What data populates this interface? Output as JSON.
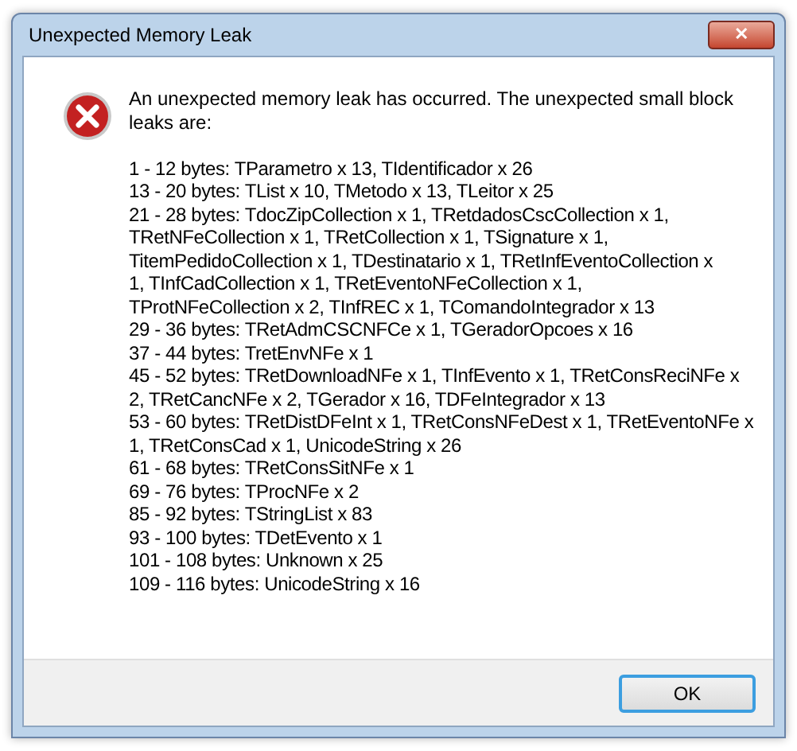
{
  "window": {
    "title": "Unexpected Memory Leak",
    "close": "✕"
  },
  "message": "An unexpected memory leak has occurred. The unexpected small block leaks are:",
  "leak_lines": [
    "1 - 12 bytes: TParametro x 13, TIdentificador x 26",
    "13 - 20 bytes: TList x 10, TMetodo x 13, TLeitor x 25",
    "21 - 28 bytes: TdocZipCollection x 1, TRetdadosCscCollection x 1,",
    "TRetNFeCollection x 1, TRetCollection x 1, TSignature x 1,",
    "TitemPedidoCollection x 1, TDestinatario x 1, TRetInfEventoCollection x",
    "1, TInfCadCollection x 1, TRetEventoNFeCollection x 1,",
    "TProtNFeCollection x 2, TInfREC x 1, TComandoIntegrador x 13",
    "29 - 36 bytes: TRetAdmCSCNFCe x 1, TGeradorOpcoes x 16",
    "37 - 44 bytes: TretEnvNFe x 1",
    "45 - 52 bytes: TRetDownloadNFe x 1, TInfEvento x 1, TRetConsReciNFe x",
    "2, TRetCancNFe x 2, TGerador x 16, TDFeIntegrador x 13",
    "53 - 60 bytes: TRetDistDFeInt x 1, TRetConsNFeDest x 1, TRetEventoNFe x",
    "1, TRetConsCad x 1, UnicodeString x 26",
    "61 - 68 bytes: TRetConsSitNFe x 1",
    "69 - 76 bytes: TProcNFe x 2",
    "85 - 92 bytes: TStringList x 83",
    "93 - 100 bytes: TDetEvento x 1",
    "101 - 108 bytes: Unknown x 25",
    "109 - 116 bytes: UnicodeString x 16"
  ],
  "buttons": [
    {
      "label": "OK",
      "default": true
    }
  ]
}
